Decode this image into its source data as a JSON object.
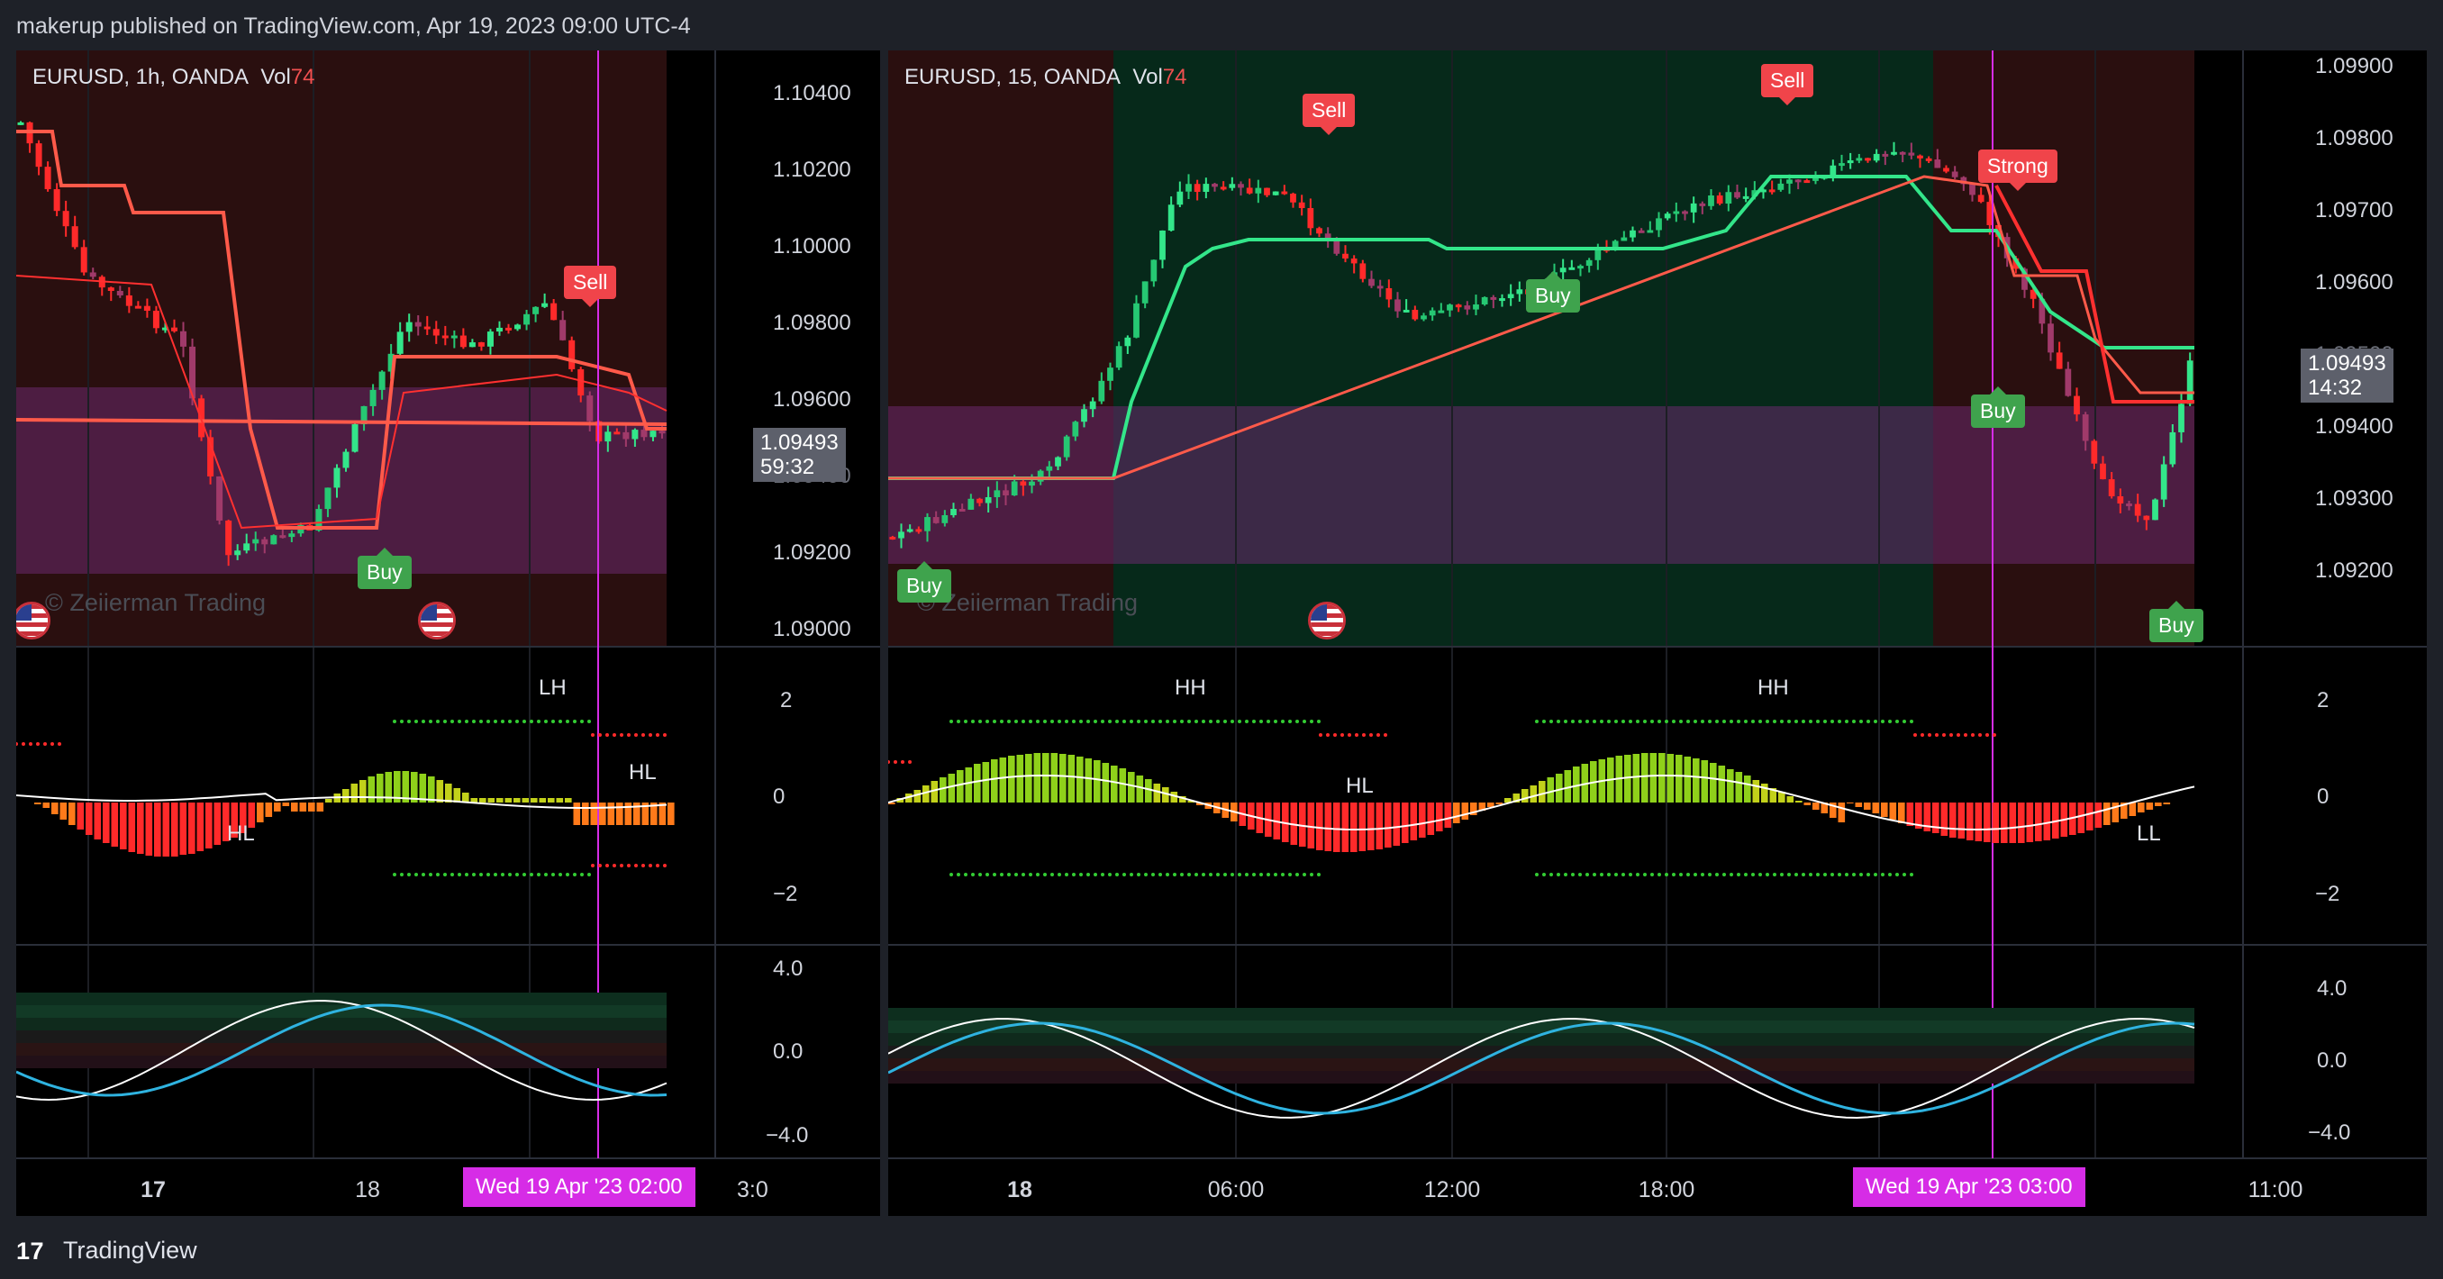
{
  "header": {
    "published_text": "makerup published on TradingView.com, Apr 19, 2023 09:00 UTC-4"
  },
  "footer": {
    "logo_glyph": "17",
    "brand": "TradingView"
  },
  "watermark": "© Zeiierman Trading",
  "left": {
    "symbol": "EURUSD, 1h, OANDA",
    "vol_label": "Vol",
    "vol_value": "74",
    "price_ticks": [
      "1.10400",
      "1.10200",
      "1.10000",
      "1.09800",
      "1.09600",
      "1.09400",
      "1.09200",
      "1.09000"
    ],
    "osc_ticks": [
      "2",
      "0",
      "−2"
    ],
    "wave_ticks": [
      "4.0",
      "0.0",
      "−4.0"
    ],
    "last_price": "1.09493",
    "countdown": "59:32",
    "time_ticks": [
      "17",
      "18"
    ],
    "cursor_time": "Wed 19 Apr '23   02:00",
    "cursor_tail": "3:0",
    "signals": {
      "sell": "Sell",
      "buy": "Buy"
    },
    "pivots": {
      "lh": "LH",
      "hl_left": "HL",
      "hl_right": "HL"
    }
  },
  "right": {
    "symbol": "EURUSD, 15, OANDA",
    "vol_label": "Vol",
    "vol_value": "74",
    "price_ticks": [
      "1.09900",
      "1.09800",
      "1.09700",
      "1.09600",
      "1.09500",
      "1.09400",
      "1.09300",
      "1.09200"
    ],
    "osc_ticks": [
      "2",
      "0",
      "−2"
    ],
    "wave_ticks": [
      "4.0",
      "0.0",
      "−4.0"
    ],
    "last_price": "1.09493",
    "countdown": "14:32",
    "time_ticks": [
      "18",
      "06:00",
      "12:00",
      "18:00",
      "11:00"
    ],
    "cursor_time": "Wed 19 Apr '23   03:00",
    "signals": {
      "sell1": "Sell",
      "sell2": "Sell",
      "strong": "Strong",
      "buy1": "Buy",
      "buy2": "Buy",
      "buy3": "Buy",
      "buy4": "Buy"
    },
    "pivots": {
      "hh1": "HH",
      "hh2": "HH",
      "hl": "HL",
      "ll": "LL"
    }
  },
  "colors": {
    "bull": "#33e68a",
    "bear": "#ff2a2a",
    "sell_label": "#f0444a",
    "buy_label": "#3fa34d",
    "cursor": "#d62ce6",
    "purple_zone": "#6a2a6e"
  }
}
